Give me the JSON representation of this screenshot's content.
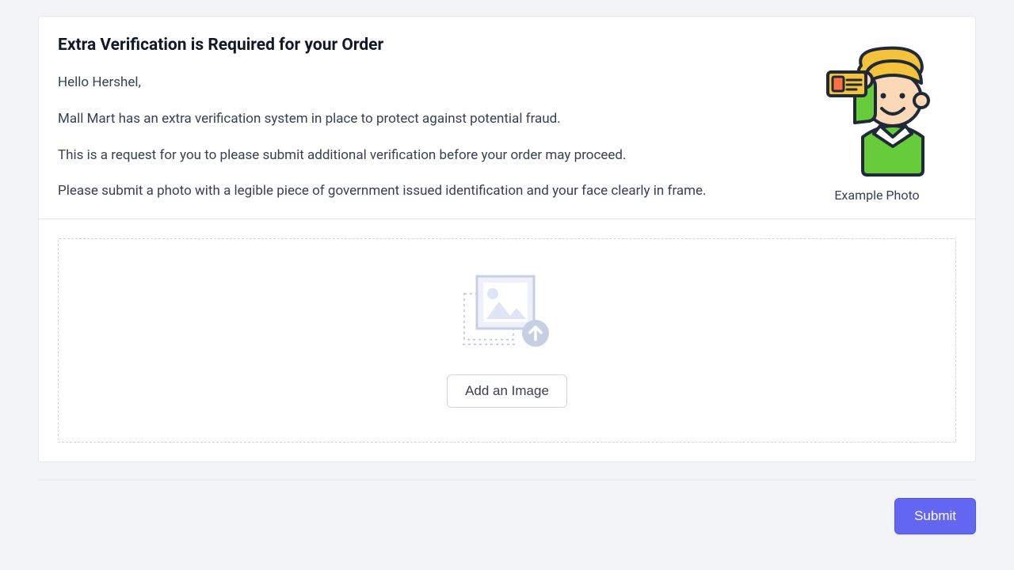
{
  "header": {
    "title": "Extra Verification is Required for your Order",
    "greeting": "Hello Hershel,",
    "line1": "Mall Mart has an extra verification system in place to protect against potential fraud.",
    "line2": "This is a request for you to please submit additional verification before your order may proceed.",
    "line3": "Please submit a photo with a legible piece of government issued identification and your face clearly in frame.",
    "example_caption": "Example Photo"
  },
  "upload": {
    "add_label": "Add an Image"
  },
  "actions": {
    "submit": "Submit"
  }
}
